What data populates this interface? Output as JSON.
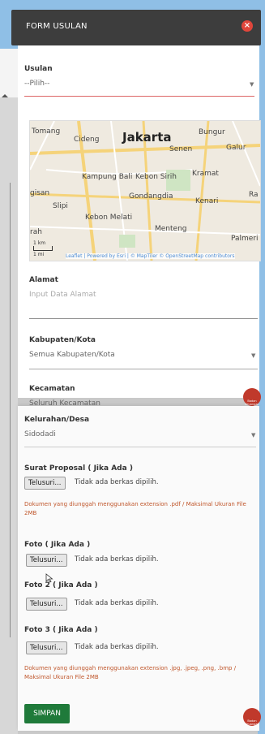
{
  "modal": {
    "title": "FORM USULAN",
    "close_icon": "close-icon"
  },
  "usulan": {
    "label": "Usulan",
    "value": "--Pilih--"
  },
  "map": {
    "labels": [
      "Tomang",
      "Cideng",
      "Jakarta",
      "Senen",
      "Bungur",
      "Galur",
      "Kampung Bali",
      "Kebon Sirih",
      "Kramat",
      "gisan",
      "Gondangdia",
      "Kenari",
      "Ra",
      "Slipi",
      "Kebon Melati",
      "rah",
      "Menteng",
      "Palmeri"
    ],
    "scale_km": "1 km",
    "scale_mi": "1 mi",
    "attribution": "Leaflet | Powered by Esri | © MapTiler © OpenStreetMap contributors"
  },
  "alamat": {
    "label": "Alamat",
    "placeholder": "Input Data Alamat"
  },
  "kabupaten": {
    "label": "Kabupaten/Kota",
    "value": "Semua Kabupaten/Kota"
  },
  "kecamatan": {
    "label": "Kecamatan",
    "value": "Seluruh Kecamatan"
  },
  "kelurahan": {
    "label": "Kelurahan/Desa",
    "value": "Sidodadi"
  },
  "files": {
    "browse_label": "Telusuri...",
    "none_selected": "Tidak ada berkas dipilih.",
    "proposal_label": "Surat Proposal ( Jika Ada )",
    "proposal_note": "Dokumen yang diunggah menggunakan extension .pdf / Maksimal Ukuran File 2MB",
    "foto_label": "Foto ( Jika Ada )",
    "foto2_label": "Foto 2 ( Jika Ada )",
    "foto3_label": "Foto 3 ( Jika Ada )",
    "foto_note": "Dokumen yang diunggah menggunakan extension .jpg, .jpeg, .png, .bmp / Maksimal Ukuran File 2MB"
  },
  "actions": {
    "save": "SIMPAN"
  },
  "logo": {
    "text": "Badan Keuangan"
  }
}
